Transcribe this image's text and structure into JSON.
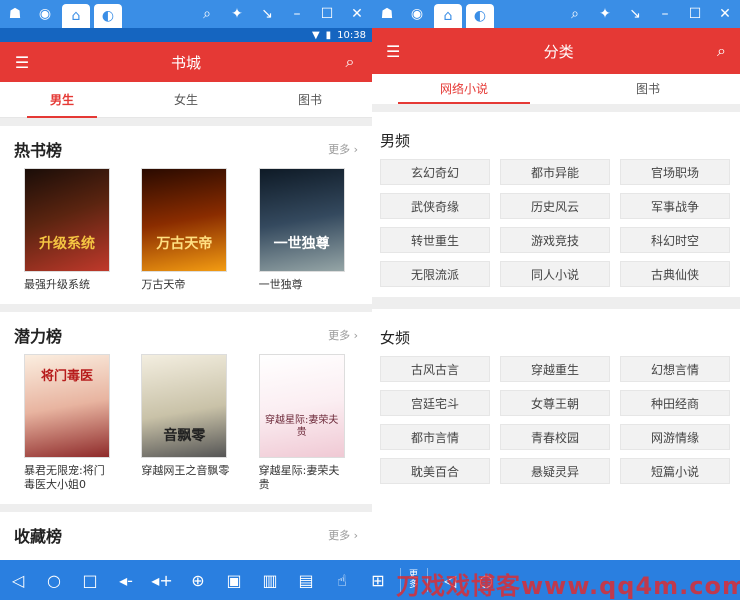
{
  "emulator": {
    "left_icons": [
      "android-icon",
      "user-icon"
    ],
    "status_time": "10:38"
  },
  "left": {
    "header_title": "书城",
    "tabs": [
      "男生",
      "女生",
      "图书"
    ],
    "sections": [
      {
        "title": "热书榜",
        "more": "更多 ›",
        "books": [
          {
            "name": "最强升级系统",
            "cover_text": "升级系统",
            "c1": "#3b1f12",
            "c2": "#c0392b"
          },
          {
            "name": "万古天帝",
            "cover_text": "万古天帝",
            "c1": "#5a1a00",
            "c2": "#e67e22"
          },
          {
            "name": "一世独尊",
            "cover_text": "一世独尊",
            "c1": "#1b2a3a",
            "c2": "#7f8c8d"
          }
        ]
      },
      {
        "title": "潜力榜",
        "more": "更多 ›",
        "books": [
          {
            "name": "暴君无限宠:将门毒医大小姐0",
            "cover_text": "将门毒医",
            "c1": "#f5e6d8",
            "c2": "#c0392b"
          },
          {
            "name": "穿越网王之音飘零",
            "cover_text": "音飘零",
            "c1": "#e8e2d0",
            "c2": "#444444"
          },
          {
            "name": "穿越星际:妻荣夫贵",
            "cover_text": "穿越星际:妻荣夫贵",
            "c1": "#f7f3f3",
            "c2": "#e8b7c4"
          }
        ]
      }
    ],
    "third_section": {
      "title": "收藏榜",
      "more": "更多 ›"
    }
  },
  "right": {
    "header_title": "分类",
    "tabs": [
      "网络小说",
      "图书"
    ],
    "categories": [
      {
        "title": "男频",
        "items": [
          "玄幻奇幻",
          "都市异能",
          "官场职场",
          "武侠奇缘",
          "历史风云",
          "军事战争",
          "转世重生",
          "游戏竞技",
          "科幻时空",
          "无限流派",
          "同人小说",
          "古典仙侠"
        ]
      },
      {
        "title": "女频",
        "items": [
          "古风古言",
          "穿越重生",
          "幻想言情",
          "宫廷宅斗",
          "女尊王朝",
          "种田经商",
          "都市言情",
          "青春校园",
          "网游情缘",
          "耽美百合",
          "悬疑灵异",
          "短篇小说"
        ]
      }
    ]
  },
  "navbar": {
    "more_label": "更多"
  },
  "watermark": "刀戏戏博客www.qq4m.com",
  "colors": {
    "accent": "#e53935",
    "emulator": "#3a8ee6"
  }
}
